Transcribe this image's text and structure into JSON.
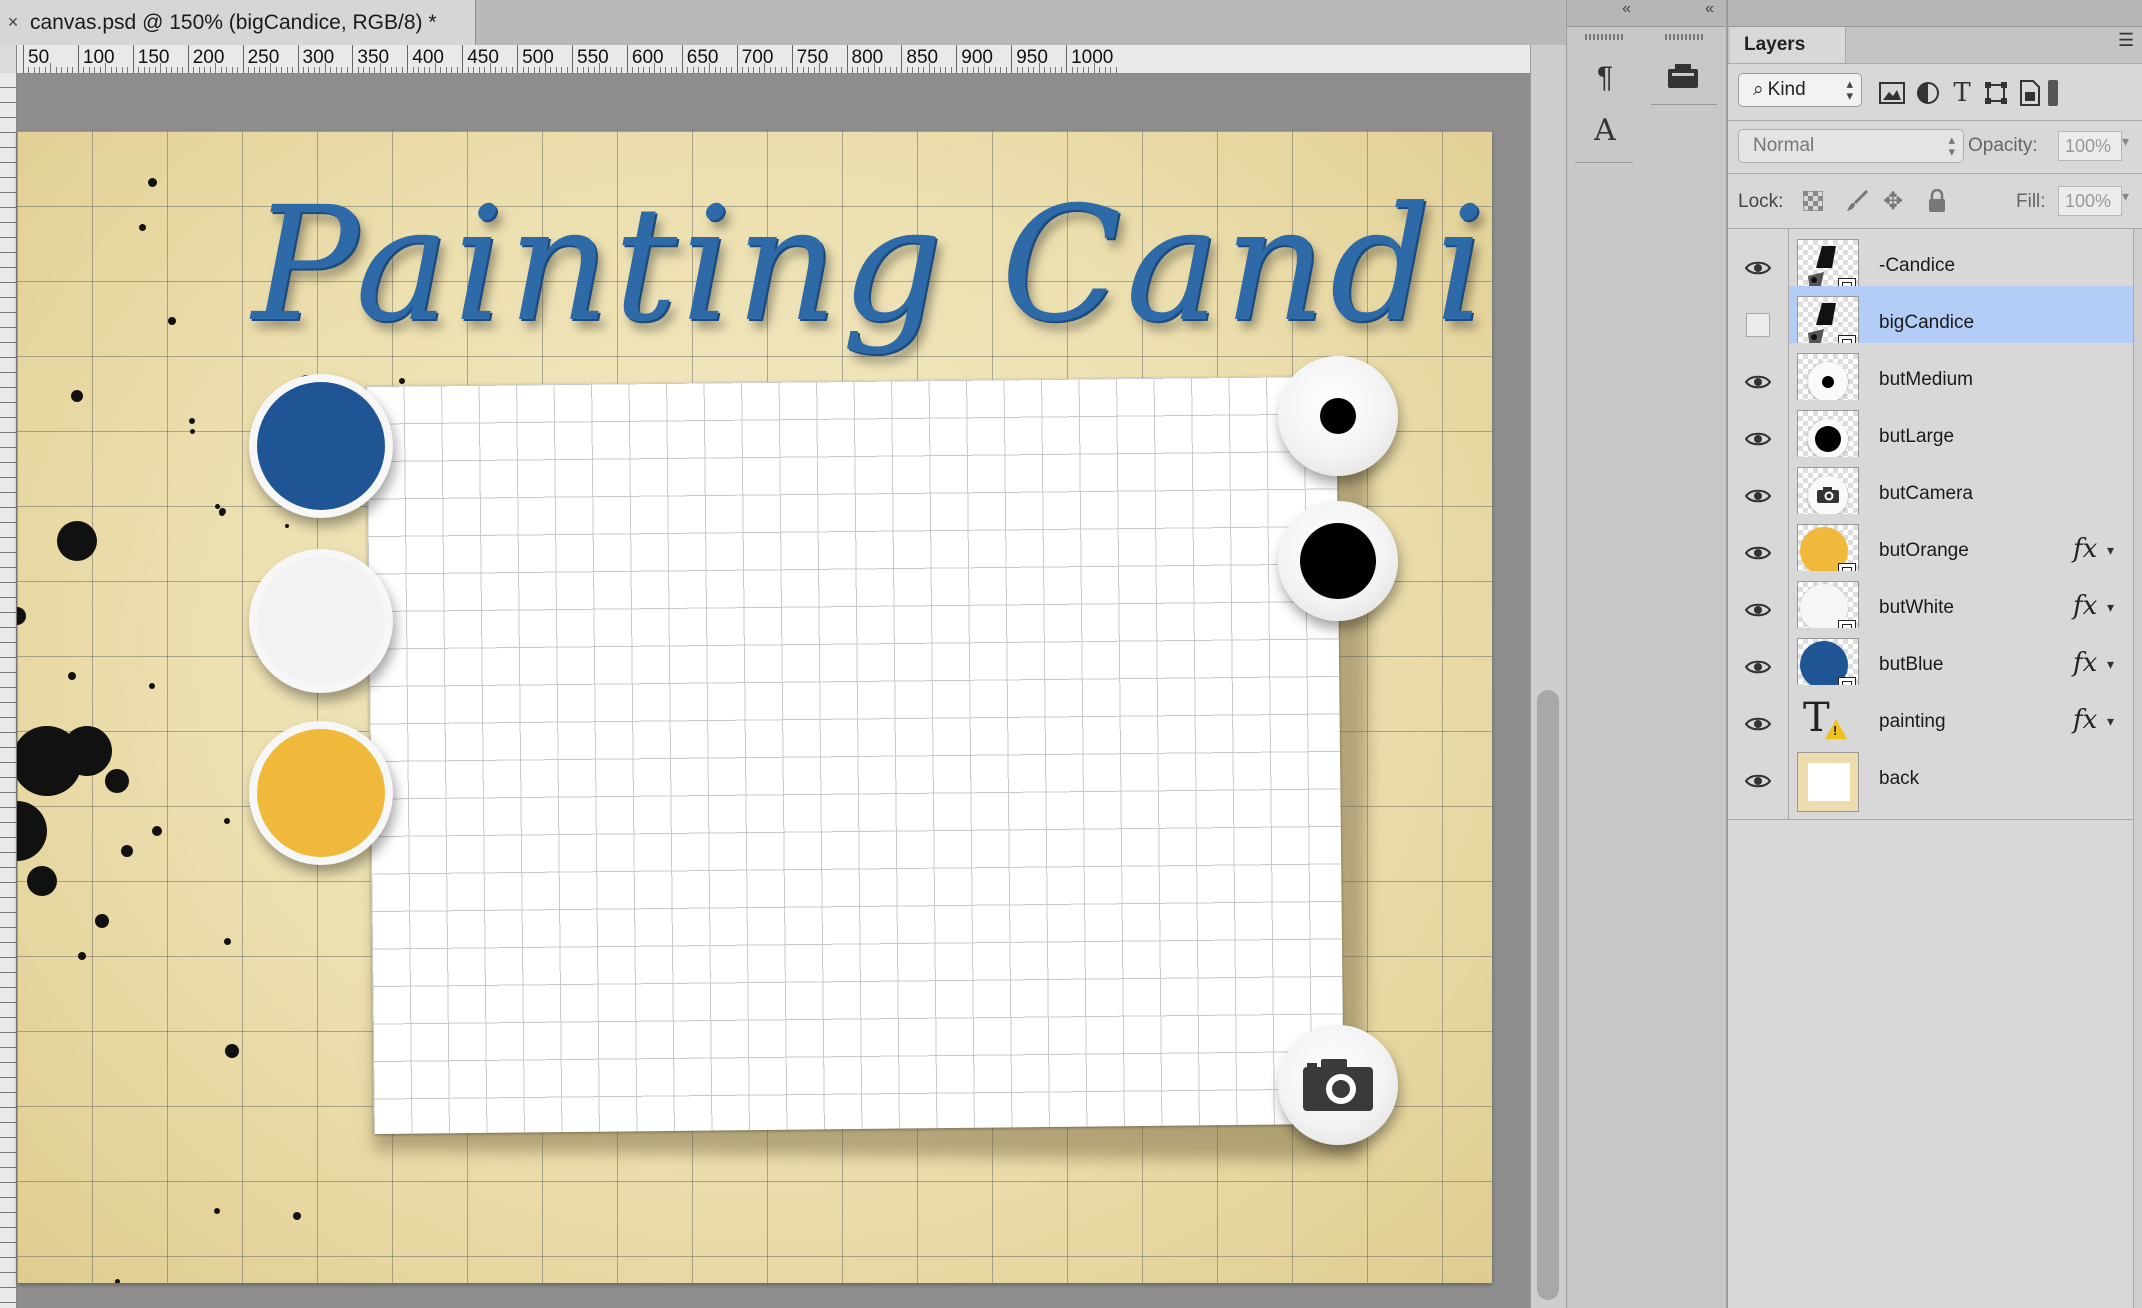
{
  "document": {
    "tab_title": "canvas.psd @ 150% (bigCandice, RGB/8) *",
    "close_glyph": "×"
  },
  "ruler": {
    "labels": [
      "50",
      "100",
      "150",
      "200",
      "250",
      "300",
      "350",
      "400",
      "450",
      "500",
      "550",
      "600",
      "650",
      "700",
      "750",
      "800",
      "850",
      "900",
      "950",
      "1000"
    ]
  },
  "artwork": {
    "title": "Painting Candice",
    "title_color": "#2f6aa8",
    "buttons": {
      "blue": "#1f5595",
      "white": "#f2f2f4",
      "orange": "#f0b93b"
    },
    "icons": {
      "medium_brush": "brush-medium-icon",
      "large_brush": "brush-large-icon",
      "camera": "camera-icon"
    }
  },
  "tool_strips": {
    "collapse_glyph": "«",
    "paragraph_icon": "¶",
    "character_icon": "A"
  },
  "layers_panel": {
    "tab_label": "Layers",
    "menu_glyph": "☰",
    "filter": {
      "kind_label": "Kind",
      "icons": [
        "image-filter-icon",
        "adjustment-filter-icon",
        "type-filter-icon",
        "shape-filter-icon",
        "smart-object-filter-icon"
      ]
    },
    "blend_mode": "Normal",
    "opacity_label": "Opacity:",
    "opacity_value": "100%",
    "lock_label": "Lock:",
    "fill_label": "Fill:",
    "fill_value": "100%",
    "layers": [
      {
        "name": "-Candice",
        "visible": true,
        "selected": false,
        "fx": false,
        "thumb": "candice-smart-object"
      },
      {
        "name": "bigCandice",
        "visible": false,
        "selected": true,
        "fx": false,
        "thumb": "candice-smart-object"
      },
      {
        "name": "butMedium",
        "visible": true,
        "selected": false,
        "fx": false,
        "thumb": "medium-dot"
      },
      {
        "name": "butLarge",
        "visible": true,
        "selected": false,
        "fx": false,
        "thumb": "large-dot"
      },
      {
        "name": "butCamera",
        "visible": true,
        "selected": false,
        "fx": false,
        "thumb": "camera"
      },
      {
        "name": "butOrange",
        "visible": true,
        "selected": false,
        "fx": true,
        "thumb": "orange-circle"
      },
      {
        "name": "butWhite",
        "visible": true,
        "selected": false,
        "fx": true,
        "thumb": "white-circle"
      },
      {
        "name": "butBlue",
        "visible": true,
        "selected": false,
        "fx": true,
        "thumb": "blue-circle"
      },
      {
        "name": "painting",
        "visible": true,
        "selected": false,
        "fx": true,
        "thumb": "type-layer"
      },
      {
        "name": "back",
        "visible": true,
        "selected": false,
        "fx": false,
        "thumb": "background"
      }
    ],
    "fx_label": "fx"
  }
}
